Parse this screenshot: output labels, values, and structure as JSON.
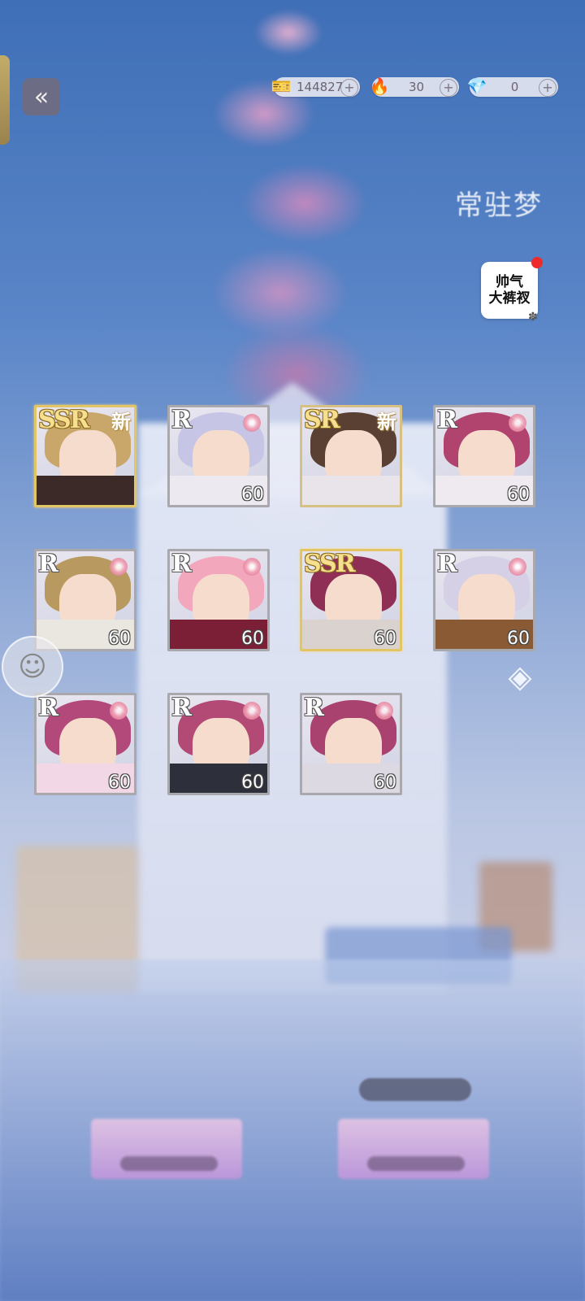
{
  "hud": {
    "back_icon": "«",
    "resources": [
      {
        "icon": "ticket-icon",
        "glyph": "🎫",
        "value": "144827",
        "plus": "+"
      },
      {
        "icon": "flame-coin-icon",
        "glyph": "🔥",
        "value": "30",
        "plus": "+"
      },
      {
        "icon": "crystal-icon",
        "glyph": "💎",
        "value": "0",
        "plus": "+"
      }
    ]
  },
  "banner": {
    "logo_text": "常驻梦"
  },
  "promo": {
    "line1": "帅气",
    "line2": "大裤衩"
  },
  "cards": [
    {
      "rarity": "SSR",
      "new": "新",
      "level": ""
    },
    {
      "rarity": "R",
      "new": "",
      "level": "60"
    },
    {
      "rarity": "SR",
      "new": "新",
      "level": ""
    },
    {
      "rarity": "R",
      "new": "",
      "level": "60"
    },
    {
      "rarity": "R",
      "new": "",
      "level": "60"
    },
    {
      "rarity": "R",
      "new": "",
      "level": "60"
    },
    {
      "rarity": "SSR",
      "new": "",
      "level": "60"
    },
    {
      "rarity": "R",
      "new": "",
      "level": "60"
    },
    {
      "rarity": "R",
      "new": "",
      "level": "60"
    },
    {
      "rarity": "R",
      "new": "",
      "level": "60"
    },
    {
      "rarity": "R",
      "new": "",
      "level": "60"
    }
  ],
  "colors": {
    "hair": [
      "#c9a66a",
      "#c7c5e6",
      "#5a4033",
      "#b1446f",
      "#b8995f",
      "#f3a7bd",
      "#8f2f55",
      "#d5d0e6",
      "#b3497a",
      "#b24a75",
      "#a9426e"
    ],
    "body": [
      "#3b2a28",
      "#eceaf0",
      "#e8e4ea",
      "#eeeaf0",
      "#eae6e0",
      "#7a1f36",
      "#d9d2cf",
      "#8a5a34",
      "#f2d7e6",
      "#2d2f3a",
      "#dcd9e2"
    ]
  }
}
